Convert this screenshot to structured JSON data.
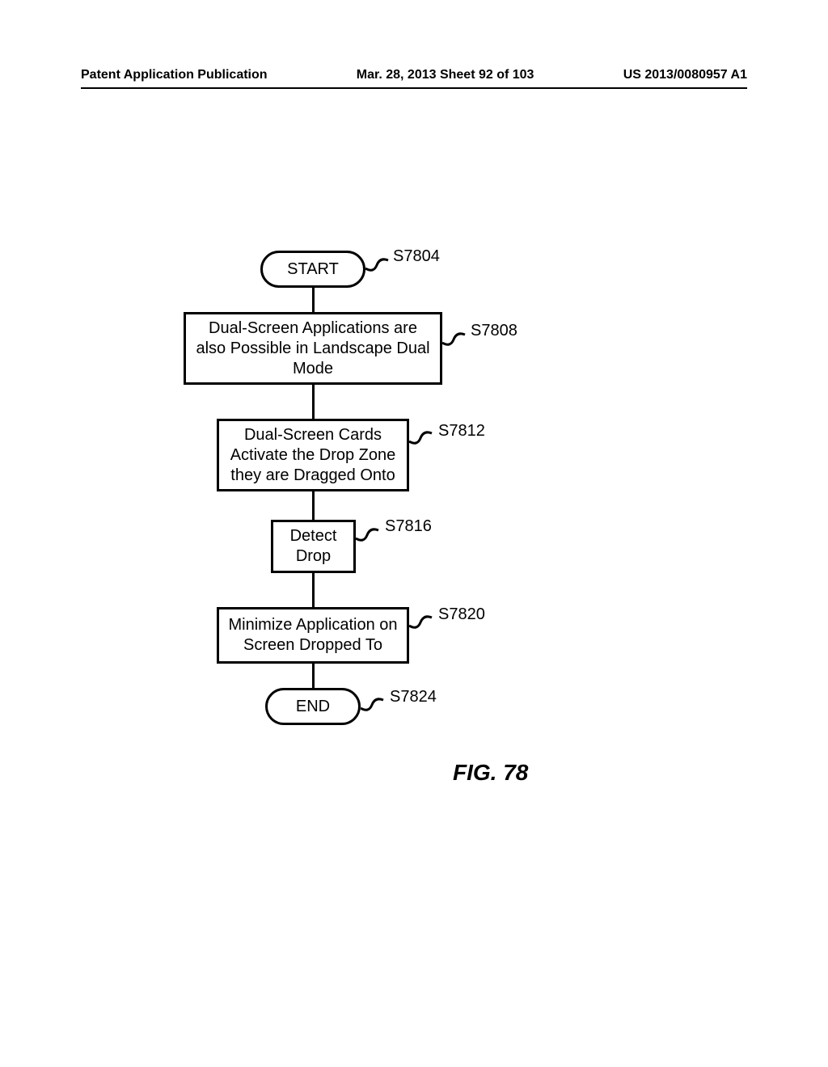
{
  "header": {
    "left": "Patent Application Publication",
    "center": "Mar. 28, 2013  Sheet 92 of 103",
    "right": "US 2013/0080957 A1"
  },
  "flow": {
    "start": "START",
    "step1": "Dual-Screen Applications are also Possible in Landscape Dual Mode",
    "step2": "Dual-Screen Cards Activate the Drop Zone they are Dragged Onto",
    "step3": "Detect Drop",
    "step4": "Minimize Application on Screen Dropped To",
    "end": "END"
  },
  "refs": {
    "r1": "S7804",
    "r2": "S7808",
    "r3": "S7812",
    "r4": "S7816",
    "r5": "S7820",
    "r6": "S7824"
  },
  "figure_caption": "FIG. 78"
}
